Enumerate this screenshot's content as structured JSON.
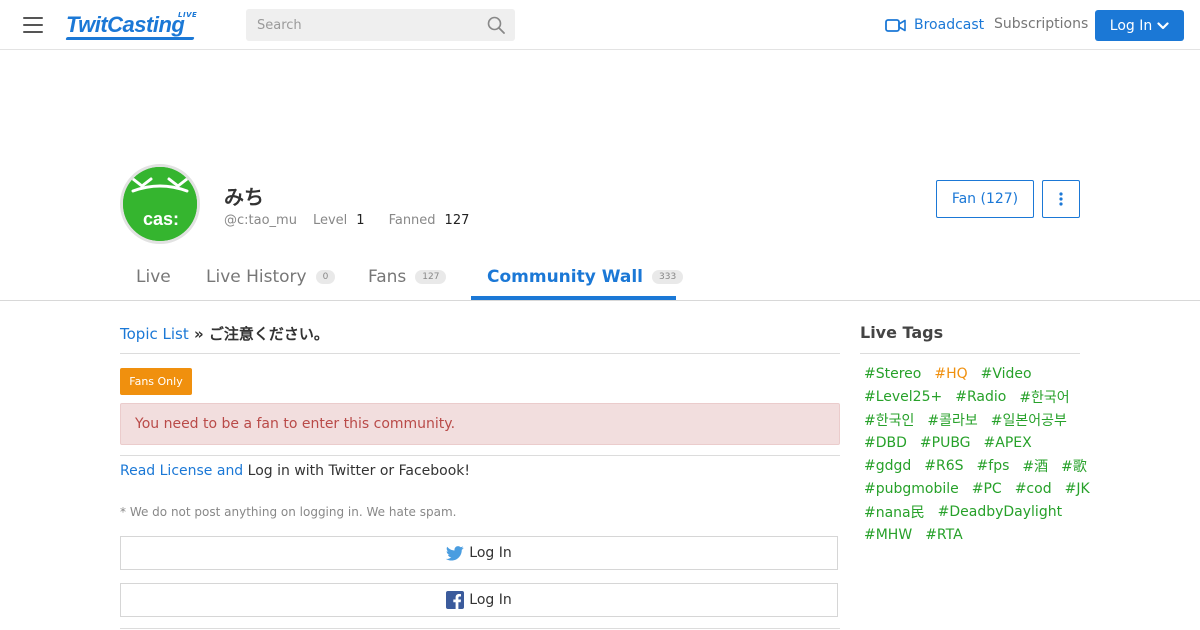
{
  "header": {
    "logo_text": "TwitCasting",
    "logo_badge": "LIVE",
    "search_placeholder": "Search",
    "broadcast_label": "Broadcast",
    "subscriptions_label": "Subscriptions",
    "login_label": "Log In",
    "accent_color": "#1b78d6"
  },
  "profile": {
    "name": "みち",
    "handle": "@c:tao_mu",
    "level_label": "Level",
    "level_value": "1",
    "fanned_label": "Fanned",
    "fanned_value": "127",
    "avatar_text": "cas:",
    "fan_button_label": "Fan (127)"
  },
  "tabs": [
    {
      "label": "Live",
      "badge": ""
    },
    {
      "label": "Live History",
      "badge": "0"
    },
    {
      "label": "Fans",
      "badge": "127"
    },
    {
      "label": "Community Wall",
      "badge": "333",
      "active": true
    }
  ],
  "main": {
    "breadcrumb_link": "Topic List",
    "breadcrumb_sep": " » ",
    "breadcrumb_current": "ご注意ください。",
    "fans_only_label": "Fans Only",
    "alert_text": "You need to be a fan to enter this community.",
    "read_license_link": "Read License and",
    "login_prompt": " Log in with Twitter or Facebook!",
    "note": "* We do not post anything on logging in. We hate spam.",
    "twitter_login_label": "Log In",
    "facebook_login_label": "Log In",
    "alert_bg": "#f2dede",
    "fans_only_color": "#f0900e"
  },
  "sidebar": {
    "title": "Live Tags",
    "tag_color": "#27a12a",
    "tags": [
      [
        "#Stereo",
        "#HQ",
        "#Video"
      ],
      [
        "#Level25+",
        "#Radio",
        "#한국어"
      ],
      [
        "#한국인",
        "#콜라보",
        "#일본어공부"
      ],
      [
        "#DBD",
        "#PUBG",
        "#APEX"
      ],
      [
        "#gdgd",
        "#R6S",
        "#fps",
        "#酒",
        "#歌"
      ],
      [
        "#pubgmobile",
        "#PC",
        "#cod",
        "#JK"
      ],
      [
        "#nana民",
        "#DeadbyDaylight"
      ],
      [
        "#MHW",
        "#RTA"
      ]
    ]
  }
}
